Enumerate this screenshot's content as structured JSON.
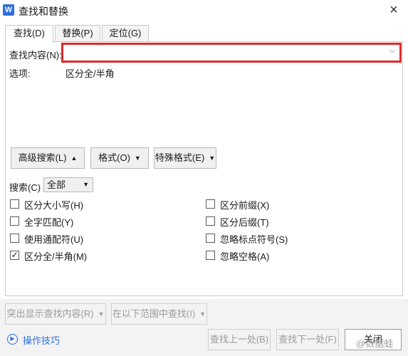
{
  "window": {
    "title": "查找和替换",
    "app_icon": "W",
    "close_glyph": "×"
  },
  "tabs": [
    {
      "label": "查找(D)"
    },
    {
      "label": "替换(P)"
    },
    {
      "label": "定位(G)"
    }
  ],
  "find": {
    "label": "查找内容(N):",
    "value": "",
    "dropdown_glyph": "⌵"
  },
  "options_row": {
    "label": "选项:",
    "value": "区分全/半角"
  },
  "buttons": {
    "advanced_search": "高级搜索(L)",
    "format": "格式(O)",
    "special_format": "特殊格式(E)"
  },
  "search": {
    "label": "搜索(C)",
    "selected": "全部"
  },
  "checkboxes_left": [
    {
      "label": "区分大小写(H)",
      "checked": false
    },
    {
      "label": "全字匹配(Y)",
      "checked": false
    },
    {
      "label": "使用通配符(U)",
      "checked": false
    },
    {
      "label": "区分全/半角(M)",
      "checked": true
    }
  ],
  "checkboxes_right": [
    {
      "label": "区分前缀(X)",
      "checked": false
    },
    {
      "label": "区分后缀(T)",
      "checked": false
    },
    {
      "label": "忽略标点符号(S)",
      "checked": false
    },
    {
      "label": "忽略空格(A)",
      "checked": false
    }
  ],
  "bottom": {
    "highlight_all": "突出显示查找内容(R)",
    "find_in": "在以下范围中查找(I)",
    "help_link": "操作技巧",
    "find_prev": "查找上一处(B)",
    "find_next": "查找下一处(F)",
    "close": "关闭"
  },
  "watermark": "@数据蛙",
  "colors": {
    "highlight_border": "#e02a2a",
    "link": "#2f6fd6"
  }
}
